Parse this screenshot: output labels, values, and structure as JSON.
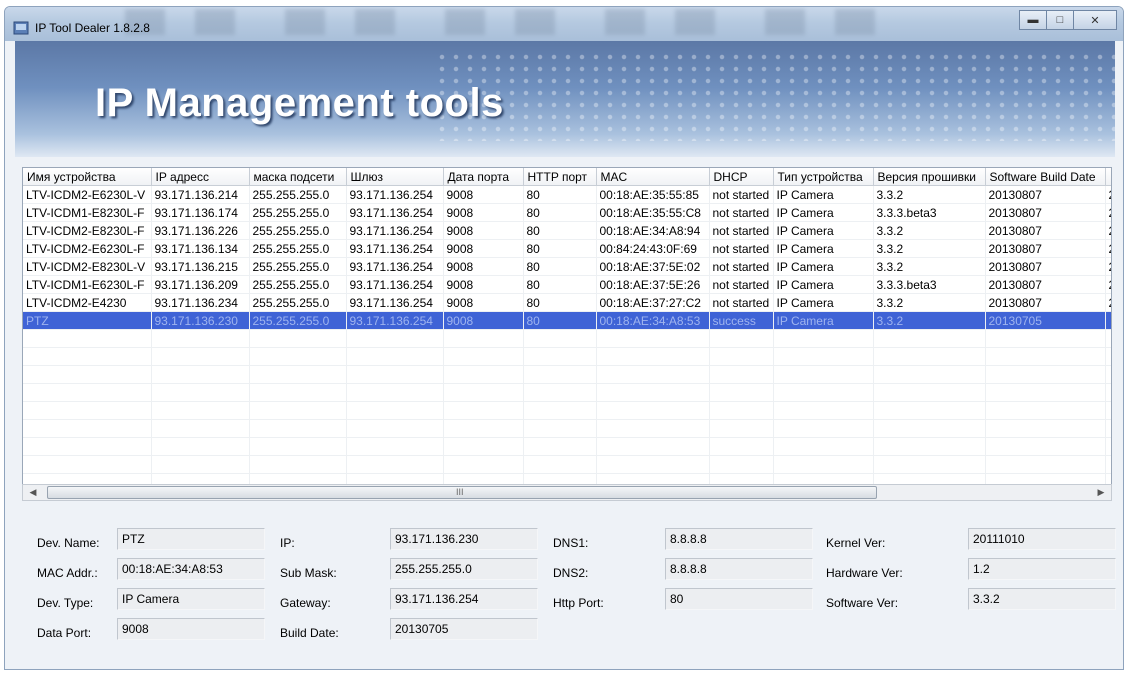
{
  "window": {
    "title": "IP Tool Dealer 1.8.2.8",
    "banner_title": "IP Management tools"
  },
  "table": {
    "columns": [
      "Имя устройства",
      "IP адресс",
      "маска подсети",
      "Шлюз",
      "Дата порта",
      "HTTP порт",
      "MAC",
      "DHCP",
      "Тип устройства",
      "Версия прошивки",
      "Software Build Date",
      ""
    ],
    "rows": [
      [
        "LTV-ICDM2-E6230L-V",
        "93.171.136.214",
        "255.255.255.0",
        "93.171.136.254",
        "9008",
        "80",
        "00:18:AE:35:55:85",
        "not started",
        "IP Camera",
        "3.3.2",
        "20130807",
        "2"
      ],
      [
        "LTV-ICDM1-E8230L-F",
        "93.171.136.174",
        "255.255.255.0",
        "93.171.136.254",
        "9008",
        "80",
        "00:18:AE:35:55:C8",
        "not started",
        "IP Camera",
        "3.3.3.beta3",
        "20130807",
        "2"
      ],
      [
        "LTV-ICDM2-E8230L-F",
        "93.171.136.226",
        "255.255.255.0",
        "93.171.136.254",
        "9008",
        "80",
        "00:18:AE:34:A8:94",
        "not started",
        "IP Camera",
        "3.3.2",
        "20130807",
        "2"
      ],
      [
        "LTV-ICDM2-E6230L-F",
        "93.171.136.134",
        "255.255.255.0",
        "93.171.136.254",
        "9008",
        "80",
        "00:84:24:43:0F:69",
        "not started",
        "IP Camera",
        "3.3.2",
        "20130807",
        "2"
      ],
      [
        "LTV-ICDM2-E8230L-V",
        "93.171.136.215",
        "255.255.255.0",
        "93.171.136.254",
        "9008",
        "80",
        "00:18:AE:37:5E:02",
        "not started",
        "IP Camera",
        "3.3.2",
        "20130807",
        "2"
      ],
      [
        "LTV-ICDM1-E6230L-F",
        "93.171.136.209",
        "255.255.255.0",
        "93.171.136.254",
        "9008",
        "80",
        "00:18:AE:37:5E:26",
        "not started",
        "IP Camera",
        "3.3.3.beta3",
        "20130807",
        "2"
      ],
      [
        "LTV-ICDM2-E4230",
        "93.171.136.234",
        "255.255.255.0",
        "93.171.136.254",
        "9008",
        "80",
        "00:18:AE:37:27:C2",
        "not started",
        "IP Camera",
        "3.3.2",
        "20130807",
        "2"
      ],
      [
        "PTZ",
        "93.171.136.230",
        "255.255.255.0",
        "93.171.136.254",
        "9008",
        "80",
        "00:18:AE:34:A8:53",
        "success",
        "IP Camera",
        "3.3.2",
        "20130705",
        ""
      ]
    ],
    "selected_row": 7
  },
  "details": {
    "dev_name_label": "Dev. Name:",
    "dev_name": "PTZ",
    "mac_label": "MAC Addr.:",
    "mac": "00:18:AE:34:A8:53",
    "dev_type_label": "Dev. Type:",
    "dev_type": "IP Camera",
    "data_port_label": "Data Port:",
    "data_port": "9008",
    "ip_label": "IP:",
    "ip": "93.171.136.230",
    "sub_mask_label": "Sub Mask:",
    "sub_mask": "255.255.255.0",
    "gateway_label": "Gateway:",
    "gateway": "93.171.136.254",
    "build_date_label": "Build Date:",
    "build_date": "20130705",
    "dns1_label": "DNS1:",
    "dns1": "8.8.8.8",
    "dns2_label": "DNS2:",
    "dns2": "8.8.8.8",
    "http_port_label": "Http Port:",
    "http_port": "80",
    "kernel_label": "Kernel Ver:",
    "kernel": "20111010",
    "hardware_label": "Hardware Ver:",
    "hardware": "1.2",
    "software_label": "Software Ver:",
    "software": "3.3.2"
  },
  "scrollbar": {
    "grip": "III"
  },
  "icons": {
    "minimize": "minimize-icon",
    "maximize": "maximize-icon",
    "close": "close-icon"
  }
}
